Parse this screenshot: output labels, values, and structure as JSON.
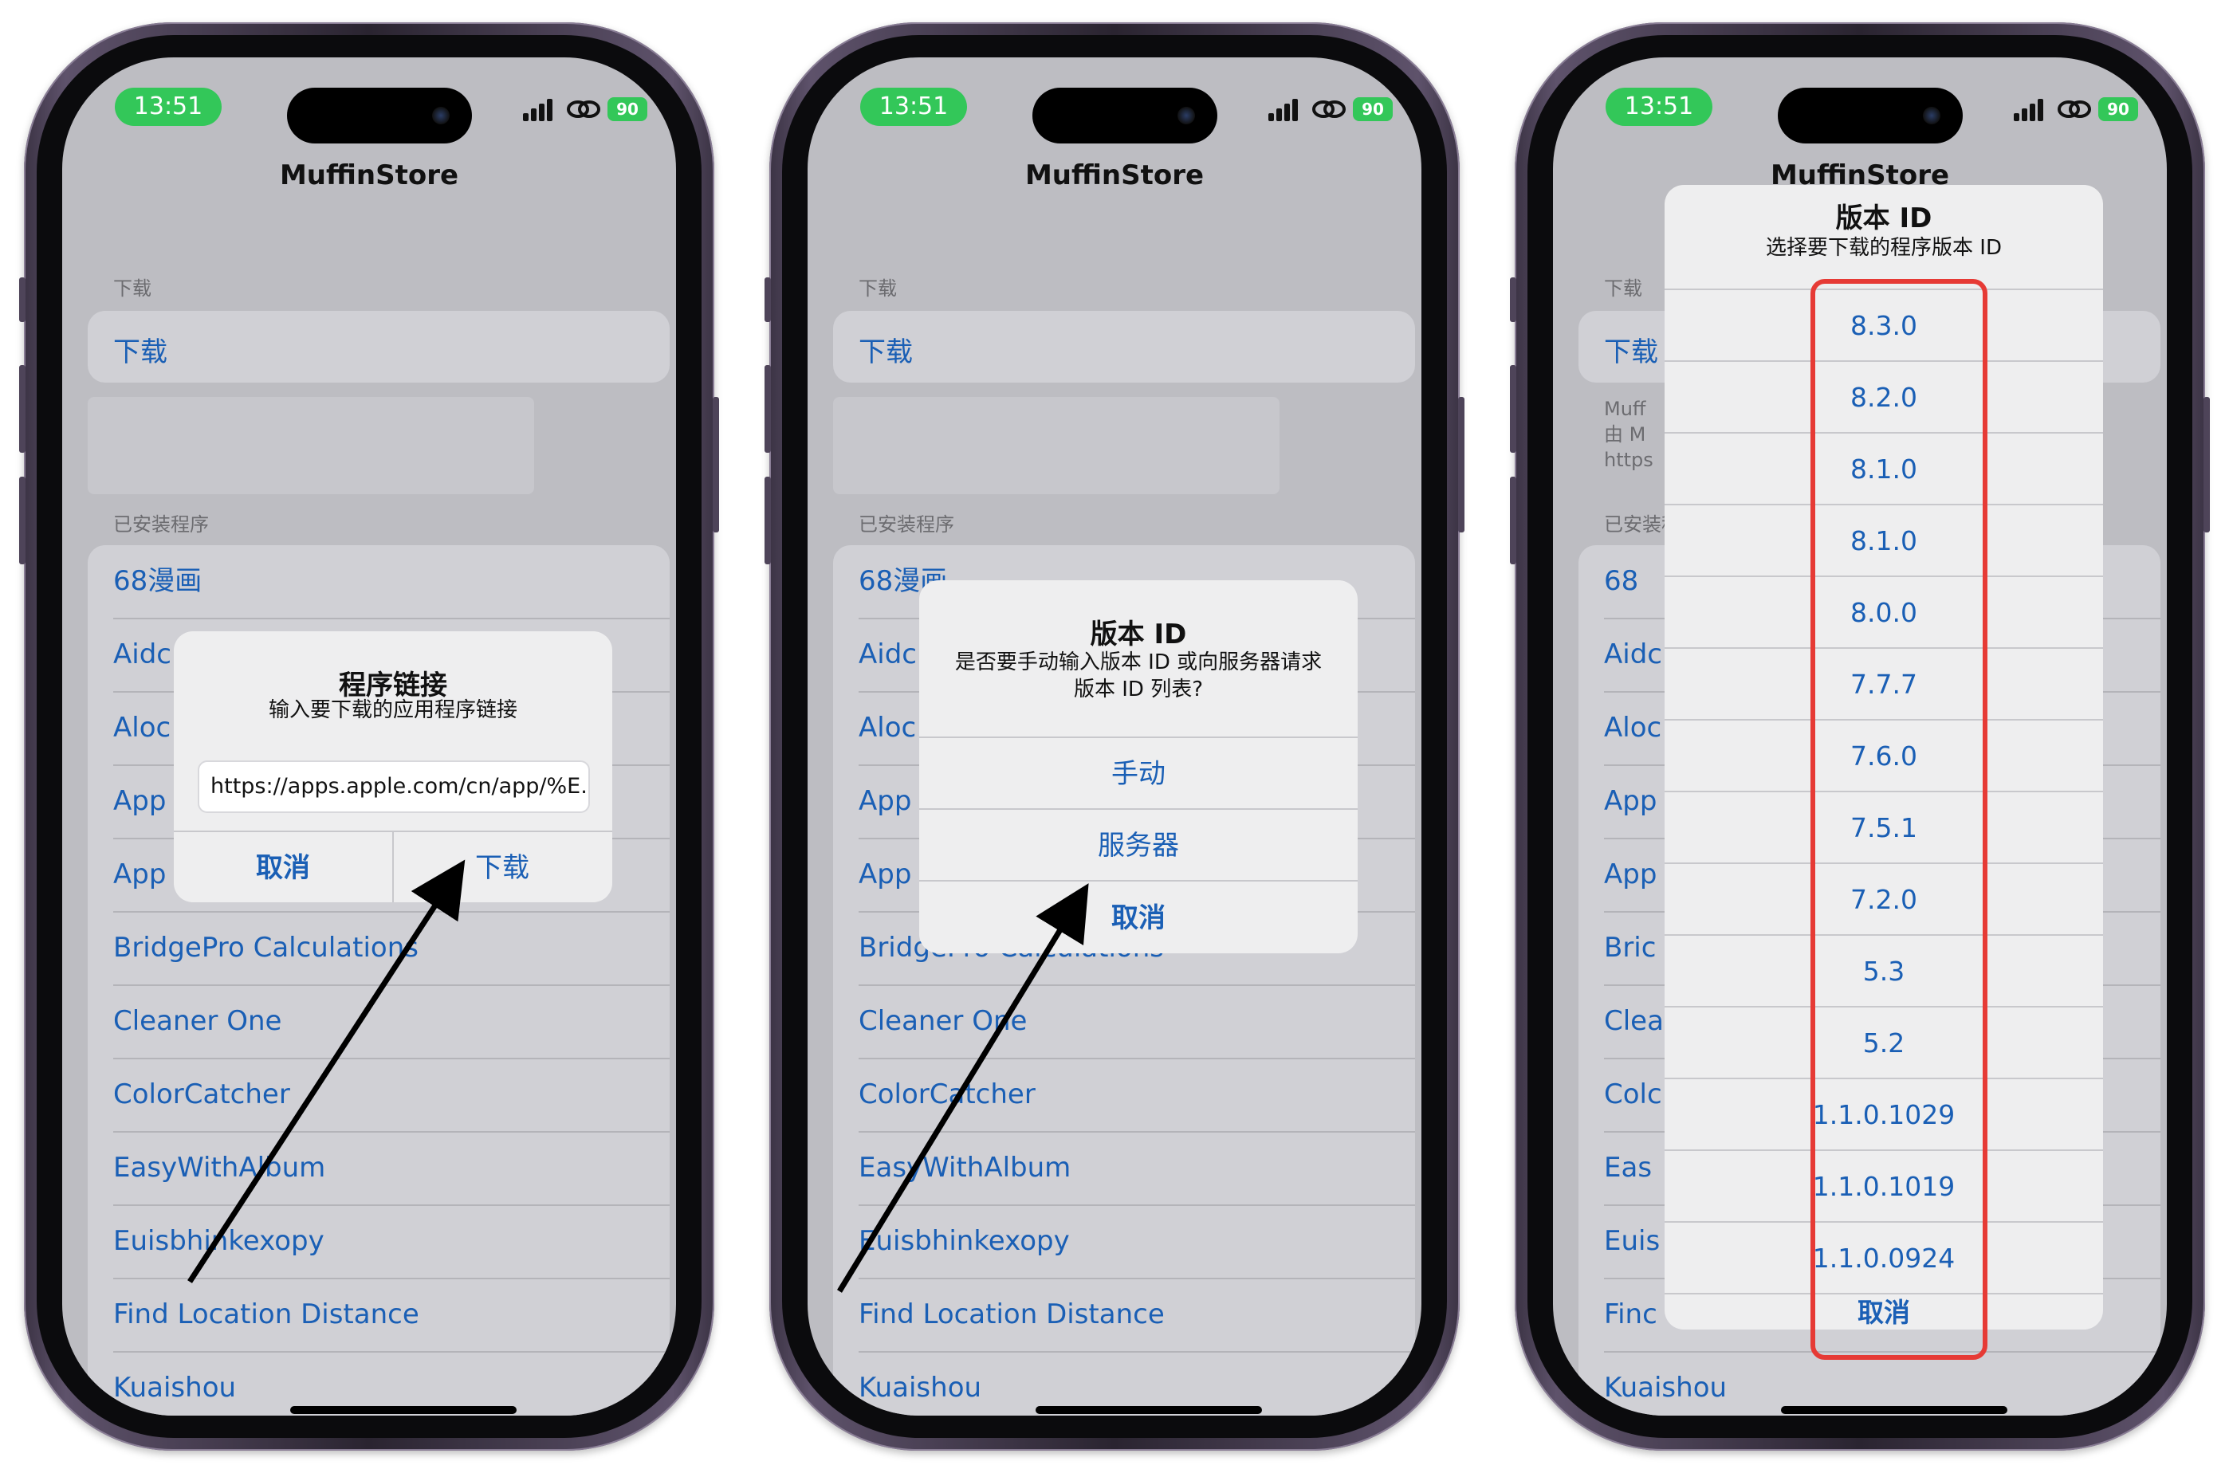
{
  "status": {
    "time": "13:51",
    "battery": "90"
  },
  "app": {
    "title": "MuffinStore"
  },
  "sections": {
    "download_header": "下载",
    "installed_header": "已安装程序"
  },
  "download_cell": "下载",
  "footer_partial": [
    "Muff",
    "由 M",
    "https"
  ],
  "installed_apps": [
    "68漫画",
    "Aidc",
    "Aloc",
    "App",
    "App",
    "BridgePro Calculations",
    "Cleaner One",
    "ColorCatcher",
    "EasyWithAlbum",
    "Euisbhinkexopy",
    "Find Location Distance",
    "Kuaishou"
  ],
  "phone1": {
    "alert": {
      "title": "程序链接",
      "message": "输入要下载的应用程序链接",
      "input_value": "https://apps.apple.com/cn/app/%E...",
      "cancel": "取消",
      "confirm": "下载"
    }
  },
  "phone2": {
    "alert": {
      "title": "版本 ID",
      "message_line1": "是否要手动输入版本 ID 或向服务器请求",
      "message_line2": "版本 ID 列表?",
      "manual": "手动",
      "server": "服务器",
      "cancel": "取消"
    }
  },
  "phone3": {
    "list_alert": {
      "title": "版本 ID",
      "message": "选择要下载的程序版本 ID",
      "versions": [
        "8.3.0",
        "8.2.0",
        "8.1.0",
        "8.1.0",
        "8.0.0",
        "7.7.7",
        "7.6.0",
        "7.5.1",
        "7.2.0",
        "5.3",
        "5.2",
        "1.1.0.1029",
        "1.1.0.1019",
        "1.1.0.0924"
      ],
      "cancel": "取消"
    },
    "truncated_rows": [
      "68",
      "Aidc",
      "Aloc",
      "App",
      "App",
      "Bric",
      "Clea",
      "Colc",
      "Eas",
      "Euis",
      "Finc",
      "Kuaishou"
    ]
  },
  "colors": {
    "accent": "#1a5fb5",
    "highlight": "#e63a35",
    "status_green": "#33c759"
  }
}
